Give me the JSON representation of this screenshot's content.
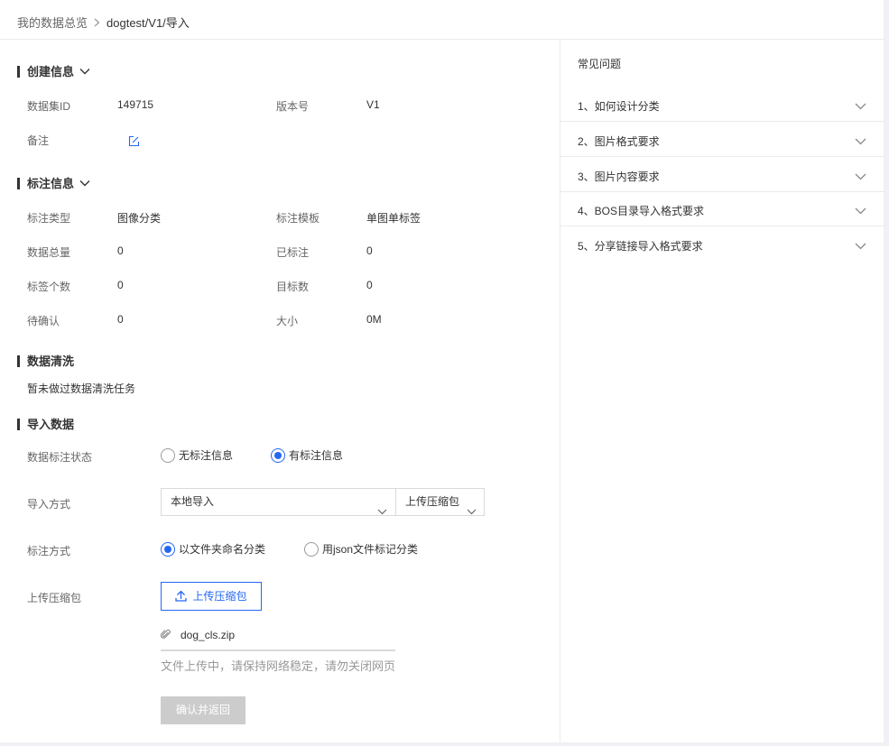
{
  "breadcrumb": {
    "root": "我的数据总览",
    "current": "dogtest/V1/导入"
  },
  "create_info": {
    "title": "创建信息",
    "dataset_id_label": "数据集ID",
    "dataset_id": "149715",
    "version_label": "版本号",
    "version": "V1",
    "remark_label": "备注"
  },
  "annotation_info": {
    "title": "标注信息",
    "type_label": "标注类型",
    "type": "图像分类",
    "template_label": "标注模板",
    "template": "单图单标签",
    "total_label": "数据总量",
    "total": "0",
    "labeled_label": "已标注",
    "labeled": "0",
    "tag_count_label": "标签个数",
    "tag_count": "0",
    "target_label": "目标数",
    "target": "0",
    "pending_label": "待确认",
    "pending": "0",
    "size_label": "大小",
    "size": "0M"
  },
  "cleaning": {
    "title": "数据清洗",
    "text": "暂未做过数据清洗任务"
  },
  "import": {
    "title": "导入数据",
    "status_label": "数据标注状态",
    "status_options": [
      "无标注信息",
      "有标注信息"
    ],
    "status_selected": "有标注信息",
    "method_label": "导入方式",
    "method_value": "本地导入",
    "upload_type_value": "上传压缩包",
    "annotate_label": "标注方式",
    "annotate_options": [
      "以文件夹命名分类",
      "用json文件标记分类"
    ],
    "annotate_selected": "以文件夹命名分类",
    "upload_label": "上传压缩包",
    "upload_button": "上传压缩包",
    "file_name": "dog_cls.zip",
    "upload_hint": "文件上传中，请保持网络稳定，请勿关闭网页",
    "confirm_button": "确认并返回"
  },
  "faq": {
    "title": "常见问题",
    "items": [
      "1、如何设计分类",
      "2、图片格式要求",
      "3、图片内容要求",
      "4、BOS目录导入格式要求",
      "5、分享链接导入格式要求"
    ]
  },
  "colors": {
    "accent": "#2468f2",
    "disabled_button": "#cccccc",
    "divider": "#ebebeb"
  }
}
